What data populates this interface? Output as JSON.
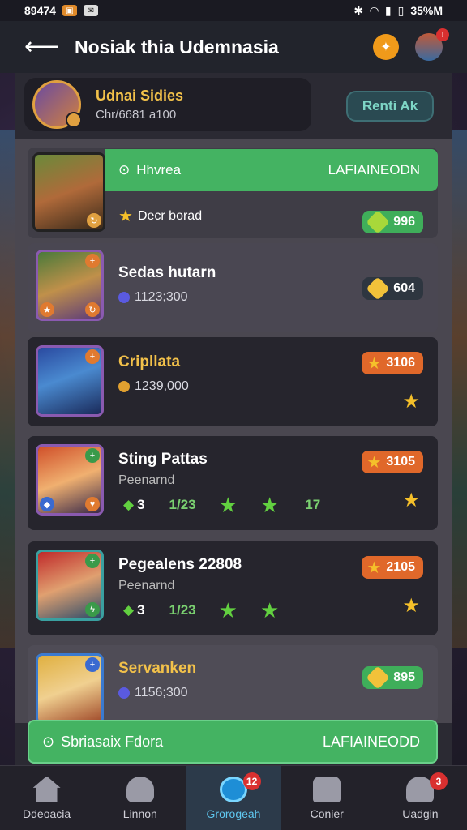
{
  "status_bar": {
    "time": "89474",
    "battery": "35%M"
  },
  "header": {
    "title": "Nosiak thia Udemnasia"
  },
  "profile": {
    "name": "Udnai Sidies",
    "sub": "Chr/6681 a100",
    "button": "Renti Ak"
  },
  "items": [
    {
      "banner_left": "Hhvrea",
      "banner_right": "LAFIAINEODN",
      "sub": "Decr borad",
      "value": "996"
    },
    {
      "name": "Sedas hutarn",
      "sub": "1123;300",
      "value": "604"
    },
    {
      "name": "Cripllata",
      "sub": "1239,000",
      "value": "3106"
    },
    {
      "name": "Sting Pattas",
      "sub": "Peenarnd",
      "stat_a": "3",
      "stat_b": "1/23",
      "stat_c": "17",
      "value": "3105"
    },
    {
      "name": "Pegealens 22808",
      "sub": "Peenarnd",
      "stat_a": "3",
      "stat_b": "1/23",
      "value": "2105"
    },
    {
      "name": "Servanken",
      "sub": "1156;300",
      "value": "895"
    }
  ],
  "bottom_banner": {
    "left": "Sbriasaix Fdora",
    "right": "LAFIAINEODD"
  },
  "tabs": [
    {
      "label": "Ddeoacia",
      "badge": ""
    },
    {
      "label": "Linnon",
      "badge": ""
    },
    {
      "label": "Grorogeah",
      "badge": "12"
    },
    {
      "label": "Conier",
      "badge": ""
    },
    {
      "label": "Uadgin",
      "badge": "3"
    }
  ],
  "colors": {
    "accent_green": "#44b362",
    "accent_orange": "#e0682a",
    "gold": "#f2c14a"
  }
}
